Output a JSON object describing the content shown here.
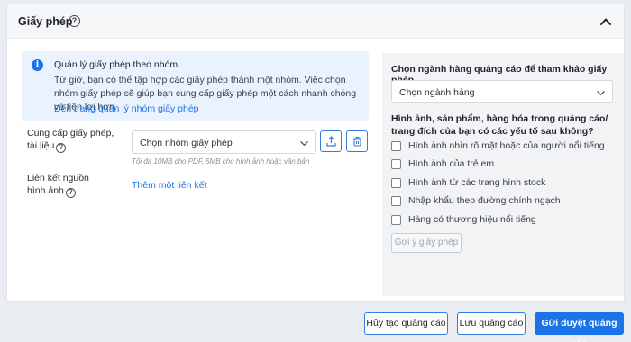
{
  "card": {
    "title": "Giấy phép",
    "help_glyph": "?"
  },
  "info": {
    "icon_glyph": "i",
    "title": "Quản lý giấy phép theo nhóm",
    "text": "Từ giờ, bạn có thể tập hợp các giấy phép thành một nhóm. Việc chọn nhóm giấy phép sẽ giúp bạn cung cấp giấy phép một cách nhanh chóng và tiện lợi hơn.",
    "link": "Đến trang quản lý nhóm giấy phép"
  },
  "form": {
    "license_label_line1": "Cung cấp giấy phép,",
    "license_label_line2": "tài liệu",
    "license_select_value": "Chọn nhóm giấy phép",
    "license_hint": "Tối đa 10MB cho PDF, 5MB cho hình ảnh hoặc văn bản",
    "link_label_line1": "Liên kết nguồn",
    "link_label_line2": "hình ảnh",
    "add_link": "Thêm một liên kết"
  },
  "panel": {
    "title": "Chọn ngành hàng quảng cáo để tham khảo giấy phép",
    "category_select_value": "Chọn ngành hàng",
    "question": "Hình ảnh, sản phẩm, hàng hóa trong quảng cáo/ trang đích của bạn có các yếu tố sau không?",
    "options": [
      "Hình ảnh nhìn rõ mặt hoặc của người nổi tiếng",
      "Hình ảnh của trẻ em",
      "Hình ảnh từ các trang hình stock",
      "Nhập khẩu theo đường chính ngạch",
      "Hàng có thương hiệu nổi tiếng"
    ],
    "suggest_button": "Gợi ý giấy phép"
  },
  "footer": {
    "cancel": "Hủy tạo quảng cáo",
    "save": "Lưu quảng cáo",
    "submit": "Gửi duyệt quảng cáo"
  },
  "colors": {
    "accent": "#1a73e8",
    "info_bg": "#eaf3fd",
    "page_bg": "#e9edf2"
  },
  "icons": {
    "collapse": "chevron-up-icon",
    "dropdown": "chevron-down-icon",
    "upload": "upload-icon",
    "delete": "trash-icon",
    "info": "info-icon",
    "help": "question-circle-icon"
  }
}
